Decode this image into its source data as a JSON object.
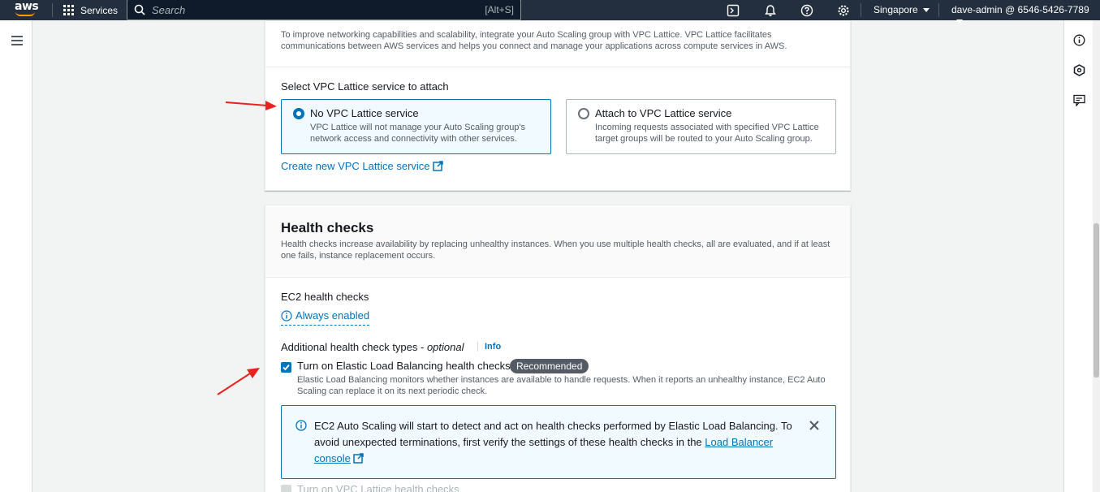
{
  "topnav": {
    "logo_text": "aws",
    "services_label": "Services",
    "search_placeholder": "Search",
    "search_shortcut": "[Alt+S]",
    "region": "Singapore",
    "account": "dave-admin @ 6546-5426-7789"
  },
  "lattice": {
    "description": "To improve networking capabilities and scalability, integrate your Auto Scaling group with VPC Lattice. VPC Lattice facilitates communications between AWS services and helps you connect and manage your applications across compute services in AWS.",
    "select_label": "Select VPC Lattice service to attach",
    "options": [
      {
        "title": "No VPC Lattice service",
        "description": "VPC Lattice will not manage your Auto Scaling group's network access and connectivity with other services.",
        "selected": true
      },
      {
        "title": "Attach to VPC Lattice service",
        "description": "Incoming requests associated with specified VPC Lattice target groups will be routed to your Auto Scaling group.",
        "selected": false
      }
    ],
    "create_link": "Create new VPC Lattice service"
  },
  "health": {
    "title": "Health checks",
    "description": "Health checks increase availability by replacing unhealthy instances. When you use multiple health checks, all are evaluated, and if at least one fails, instance replacement occurs.",
    "ec2_label": "EC2 health checks",
    "ec2_value": "Always enabled",
    "additional_label": "Additional health check types -",
    "optional": "optional",
    "info": "Info",
    "elb_checkbox_label": "Turn on Elastic Load Balancing health checks",
    "elb_checked": true,
    "recommended_badge": "Recommended",
    "elb_description": "Elastic Load Balancing monitors whether instances are available to handle requests. When it reports an unhealthy instance, EC2 Auto Scaling can replace it on its next periodic check.",
    "alert_text": "EC2 Auto Scaling will start to detect and act on health checks performed by Elastic Load Balancing. To avoid unexpected terminations, first verify the settings of these health checks in the",
    "alert_link": "Load Balancer console",
    "lattice_checkbox_label": "Turn on VPC Lattice health checks"
  },
  "colors": {
    "accent": "#0073bb",
    "nav_bg": "#232f3e",
    "annotation_arrow": "#e8231f"
  }
}
